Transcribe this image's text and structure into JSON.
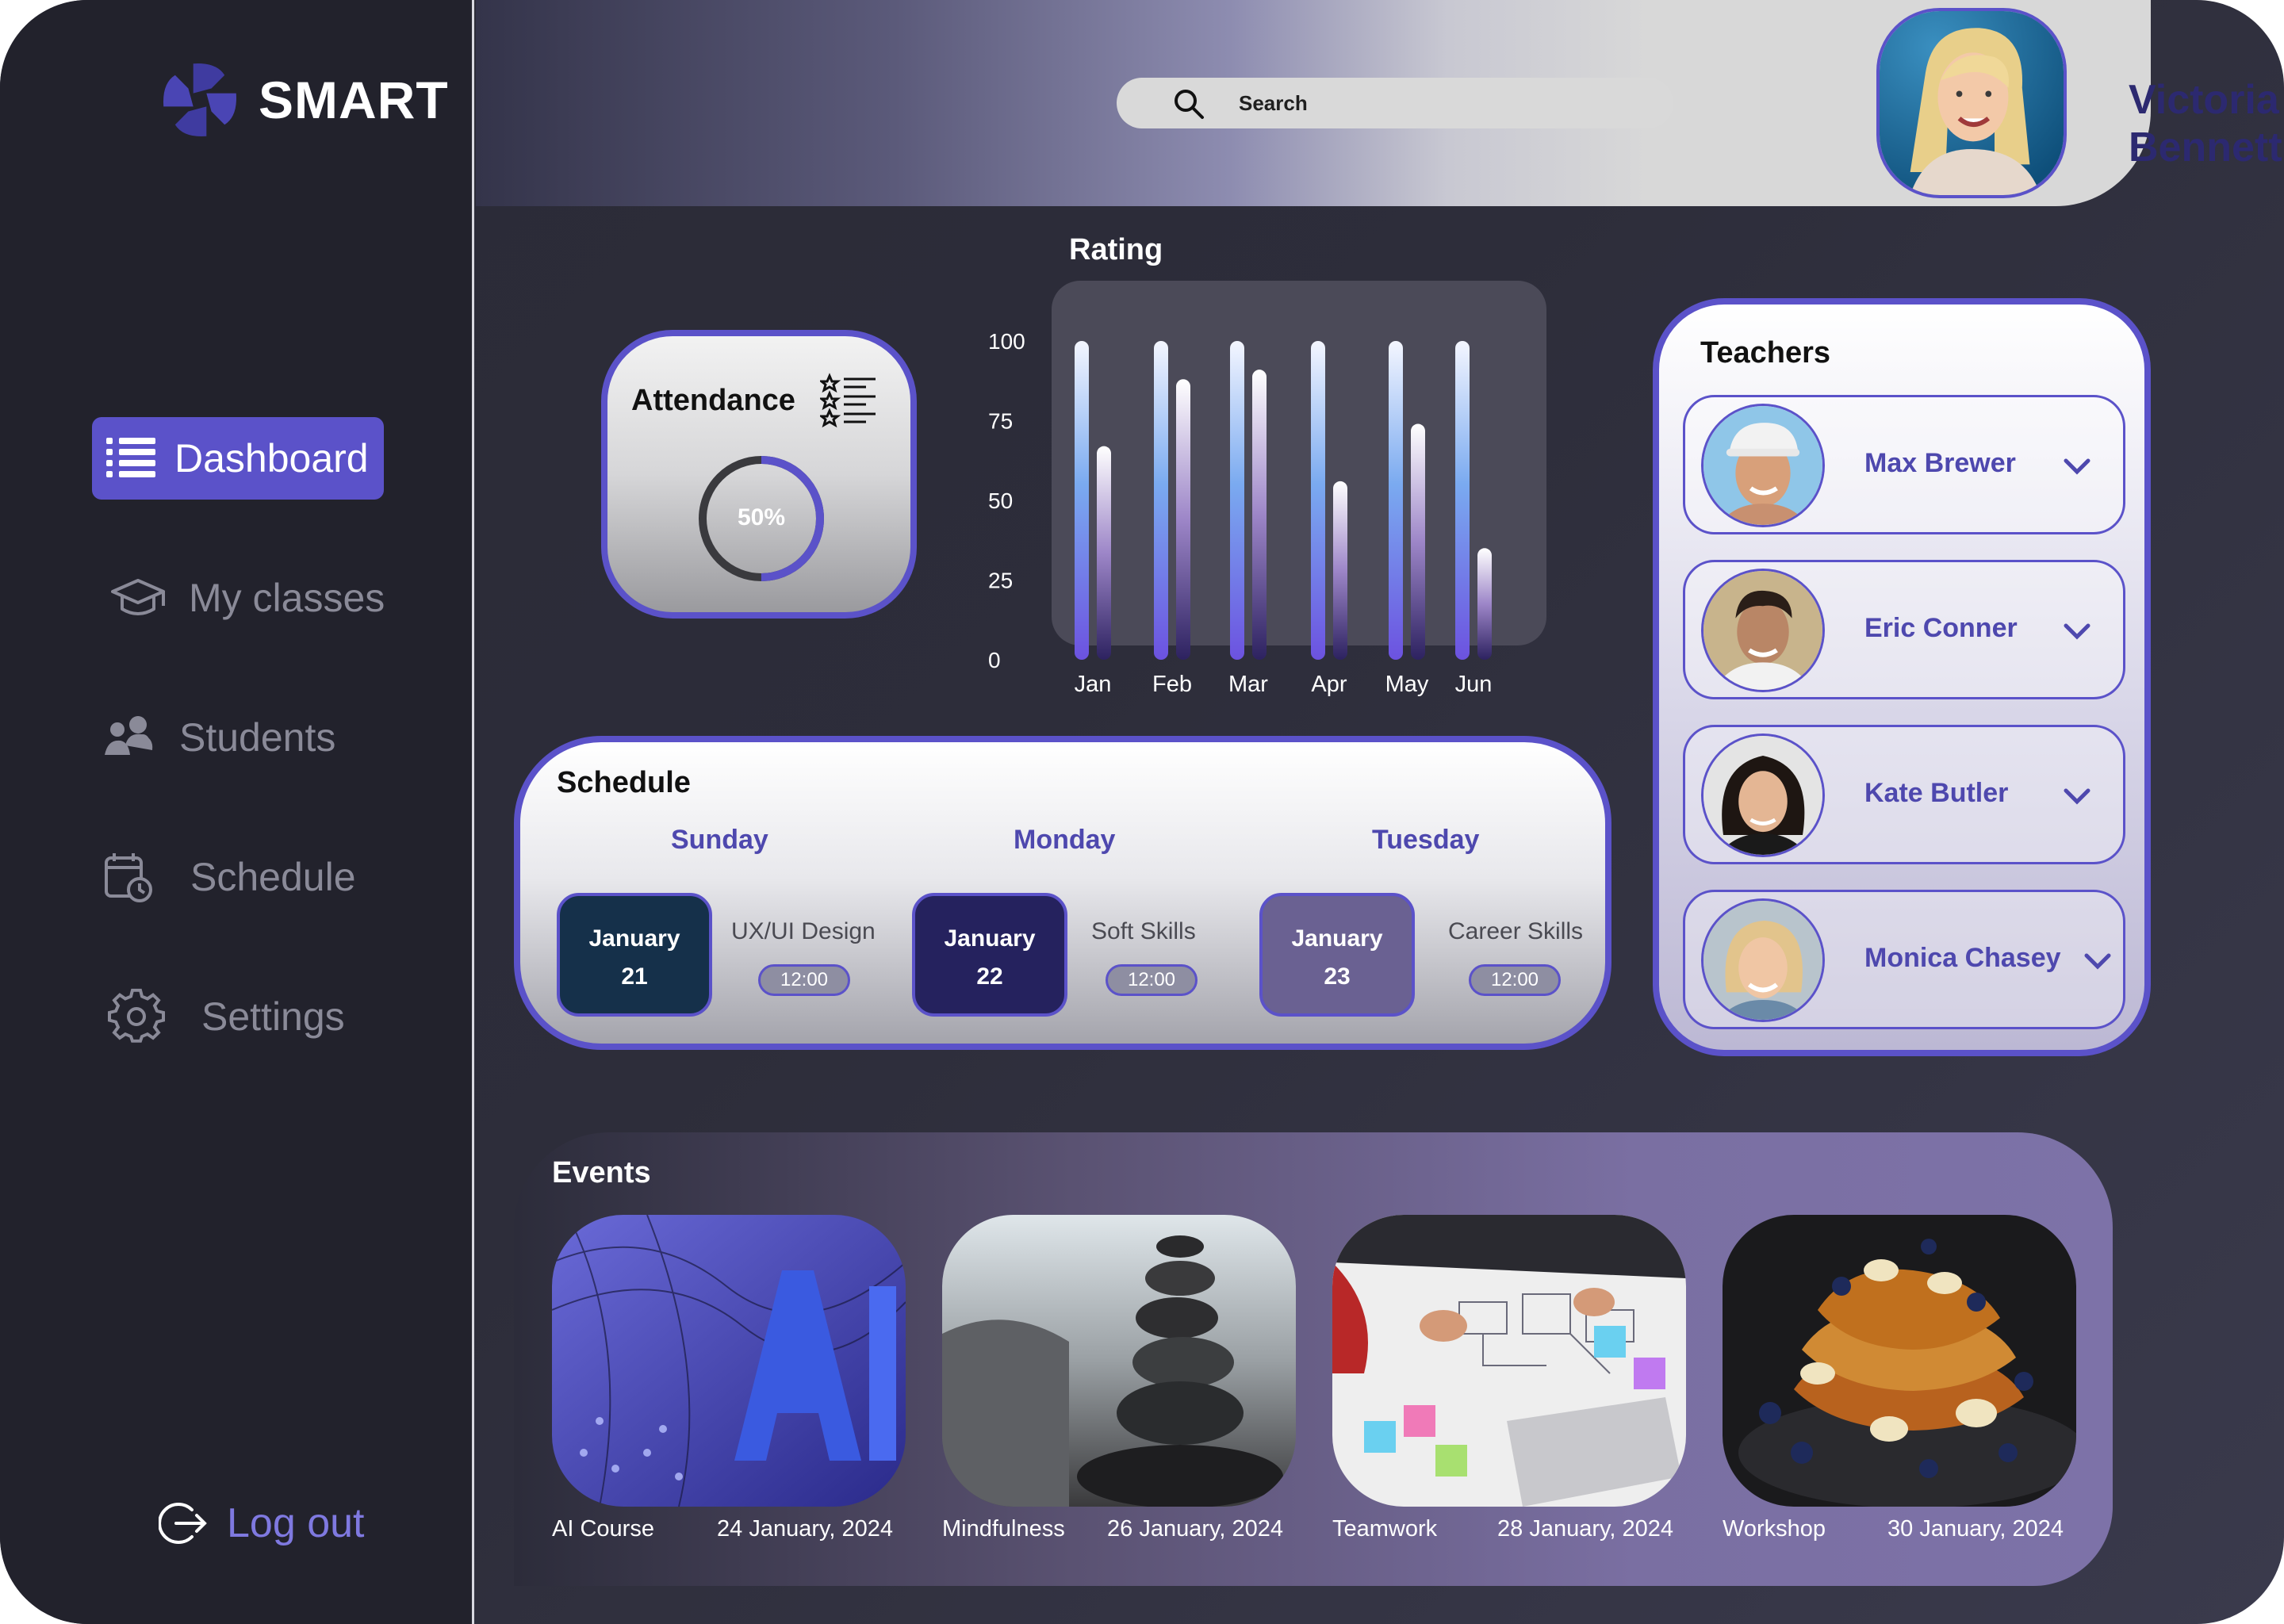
{
  "app": {
    "name": "SMART"
  },
  "colors": {
    "accent": "#5b52c9",
    "accent_text": "#4e48ae",
    "logout": "#7f79e0"
  },
  "sidebar": {
    "items": [
      {
        "label": "Dashboard",
        "icon": "list-icon",
        "active": true
      },
      {
        "label": "My classes",
        "icon": "graduation-cap-icon",
        "active": false
      },
      {
        "label": "Students",
        "icon": "students-icon",
        "active": false
      },
      {
        "label": "Schedule",
        "icon": "calendar-clock-icon",
        "active": false
      },
      {
        "label": "Settings",
        "icon": "gear-icon",
        "active": false
      }
    ],
    "logout_label": "Log out"
  },
  "header": {
    "search_placeholder": "Search",
    "user_name": "Victoria Bennett"
  },
  "attendance": {
    "title": "Attendance",
    "percent_label": "50%",
    "percent": 50
  },
  "rating": {
    "title": "Rating"
  },
  "chart_data": {
    "type": "bar",
    "title": "Rating",
    "categories": [
      "Jan",
      "Feb",
      "Mar",
      "Apr",
      "May",
      "Jun"
    ],
    "ylim": [
      0,
      100
    ],
    "yticks": [
      "100",
      "75",
      "50",
      "25",
      "0"
    ],
    "series": [
      {
        "values": [
          100,
          100,
          100,
          100,
          100,
          100
        ]
      },
      {
        "values": [
          67,
          88,
          91,
          56,
          74,
          35
        ]
      }
    ],
    "grid": false
  },
  "schedule": {
    "title": "Schedule",
    "days": [
      {
        "day": "Sunday",
        "month": "January",
        "date": "21",
        "course": "UX/UI Design",
        "time": "12:00",
        "color": "#15304a"
      },
      {
        "day": "Monday",
        "month": "January",
        "date": "22",
        "course": "Soft Skills",
        "time": "12:00",
        "color": "#25225e"
      },
      {
        "day": "Tuesday",
        "month": "January",
        "date": "23",
        "course": "Career Skills",
        "time": "12:00",
        "color": "#6a6192"
      }
    ]
  },
  "teachers": {
    "title": "Teachers",
    "list": [
      {
        "name": "Max Brewer"
      },
      {
        "name": "Eric Conner"
      },
      {
        "name": "Kate Butler"
      },
      {
        "name": "Monica Chasey"
      }
    ]
  },
  "events": {
    "title": "Events",
    "list": [
      {
        "name": "AI Course",
        "date": "24 January, 2024",
        "image": "ai-letters-photo"
      },
      {
        "name": "Mindfulness",
        "date": "26 January, 2024",
        "image": "stacked-stones-photo"
      },
      {
        "name": "Teamwork",
        "date": "28 January, 2024",
        "image": "team-whiteboard-photo"
      },
      {
        "name": "Workshop",
        "date": "30 January, 2024",
        "image": "french-toast-photo"
      }
    ]
  }
}
